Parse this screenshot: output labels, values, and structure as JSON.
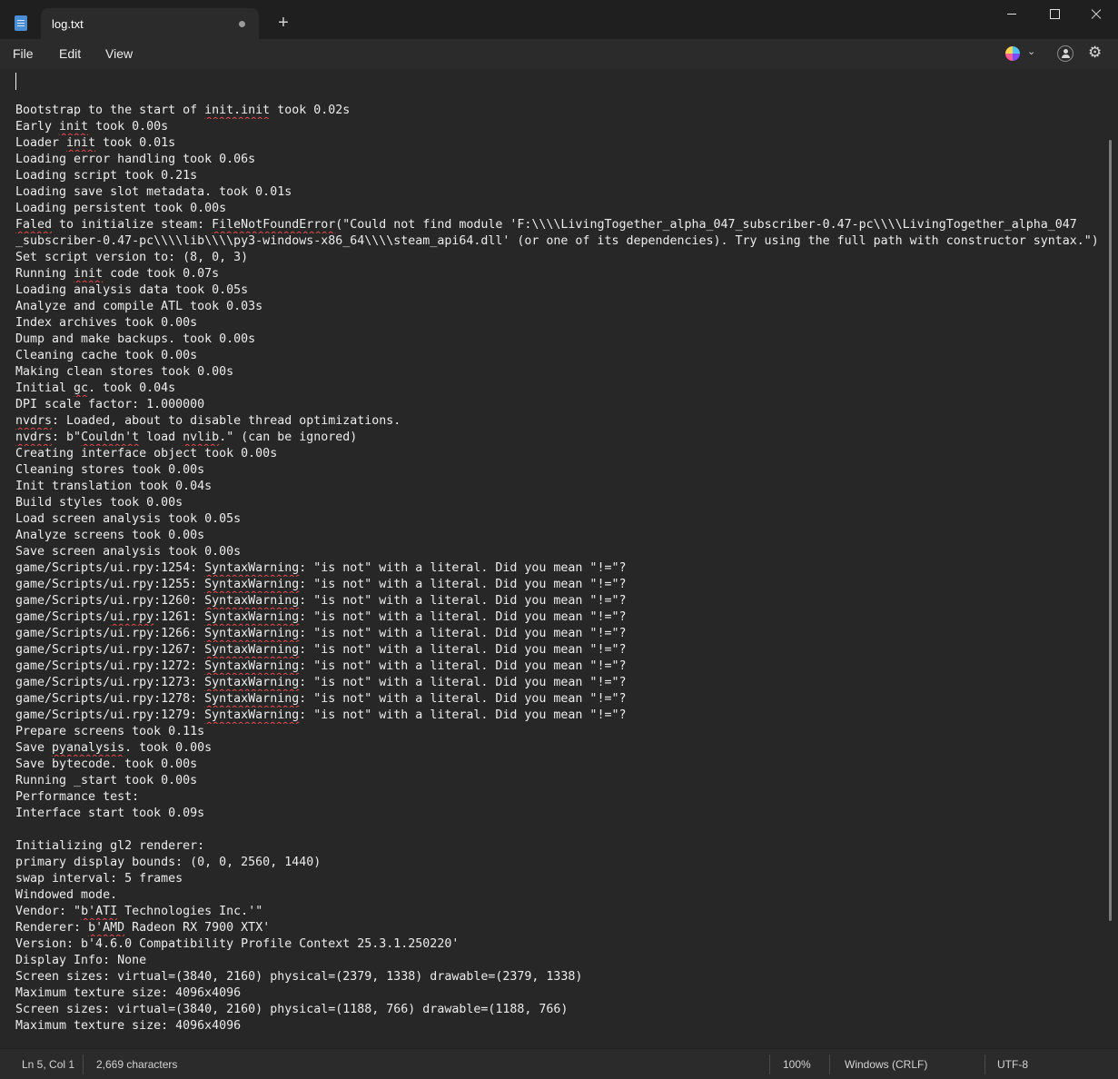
{
  "tab": {
    "title": "log.txt"
  },
  "menu": {
    "file": "File",
    "edit": "Edit",
    "view": "View"
  },
  "icons": {
    "app": "notepad-icon",
    "new_tab": "plus-icon",
    "new_tab_glyph": "+",
    "unsaved": "unsaved-dot-icon",
    "minimize": "minimize-icon",
    "maximize": "maximize-icon",
    "close": "close-icon",
    "copilot": "copilot-icon",
    "copilot_chevron": "chevron-down-icon",
    "chevron_glyph": "⌄",
    "account": "account-icon",
    "settings": "gear-icon",
    "settings_glyph": "⚙"
  },
  "colors": {
    "accent": "#4a8fd6",
    "spellcheck_underline": "#e5484d",
    "background": "#272727"
  },
  "editor": {
    "lines": [
      [
        {
          "t": ""
        }
      ],
      [
        {
          "t": "Bootstrap to the start of "
        },
        {
          "t": "init.init",
          "s": true
        },
        {
          "t": " took 0.02s"
        }
      ],
      [
        {
          "t": "Early "
        },
        {
          "t": "init",
          "s": true
        },
        {
          "t": " took 0.00s"
        }
      ],
      [
        {
          "t": "Loader "
        },
        {
          "t": "init",
          "s": true
        },
        {
          "t": " took 0.01s"
        }
      ],
      [
        {
          "t": "Loading error handling took 0.06s"
        }
      ],
      [
        {
          "t": "Loading script took 0.21s"
        }
      ],
      [
        {
          "t": "Loading save slot metadata. took 0.01s"
        }
      ],
      [
        {
          "t": "Loading persistent took 0.00s"
        }
      ],
      [
        {
          "t": "Faled",
          "s": true
        },
        {
          "t": " to initialize steam: "
        },
        {
          "t": "FileNotFoundError",
          "s": true
        },
        {
          "t": "(\"Could not find module 'F:\\\\\\\\LivingTogether_alpha_047_subscriber-0.47-pc\\\\\\\\LivingTogether_alpha_047"
        }
      ],
      [
        {
          "t": "_subscriber-0.47-pc\\\\\\\\lib\\\\\\\\py3-windows-x86_64\\\\\\\\steam_api64.dll' (or one of its dependencies). Try using the full path with constructor syntax.\")"
        }
      ],
      [
        {
          "t": "Set script version to: (8, 0, 3)"
        }
      ],
      [
        {
          "t": "Running "
        },
        {
          "t": "init",
          "s": true
        },
        {
          "t": " code took 0.07s"
        }
      ],
      [
        {
          "t": "Loading analysis data took 0.05s"
        }
      ],
      [
        {
          "t": "Analyze and compile ATL took 0.03s"
        }
      ],
      [
        {
          "t": "Index archives took 0.00s"
        }
      ],
      [
        {
          "t": "Dump and make backups. took 0.00s"
        }
      ],
      [
        {
          "t": "Cleaning cache took 0.00s"
        }
      ],
      [
        {
          "t": "Making clean stores took 0.00s"
        }
      ],
      [
        {
          "t": "Initial "
        },
        {
          "t": "gc",
          "s": true
        },
        {
          "t": ". took 0.04s"
        }
      ],
      [
        {
          "t": "DPI scale factor: 1.000000"
        }
      ],
      [
        {
          "t": "nvdrs",
          "s": true
        },
        {
          "t": ": Loaded, about to disable thread optimizations."
        }
      ],
      [
        {
          "t": "nvdrs",
          "s": true
        },
        {
          "t": ": b\""
        },
        {
          "t": "Couldn't",
          "s": true
        },
        {
          "t": " load "
        },
        {
          "t": "nvlib",
          "s": true
        },
        {
          "t": ".\" (can be ignored)"
        }
      ],
      [
        {
          "t": "Creating interface object took 0.00s"
        }
      ],
      [
        {
          "t": "Cleaning stores took 0.00s"
        }
      ],
      [
        {
          "t": "Init translation took 0.04s"
        }
      ],
      [
        {
          "t": "Build styles took 0.00s"
        }
      ],
      [
        {
          "t": "Load screen analysis took 0.05s"
        }
      ],
      [
        {
          "t": "Analyze screens took 0.00s"
        }
      ],
      [
        {
          "t": "Save screen analysis took 0.00s"
        }
      ],
      [
        {
          "t": "game/Scripts/ui.rpy:1254: "
        },
        {
          "t": "SyntaxWarning",
          "s": true
        },
        {
          "t": ": \"is not\" with a literal. Did you mean \"!=\"?"
        }
      ],
      [
        {
          "t": "game/Scripts/ui.rpy:1255: "
        },
        {
          "t": "SyntaxWarning",
          "s": true
        },
        {
          "t": ": \"is not\" with a literal. Did you mean \"!=\"?"
        }
      ],
      [
        {
          "t": "game/Scripts/ui.rpy:1260: "
        },
        {
          "t": "SyntaxWarning",
          "s": true
        },
        {
          "t": ": \"is not\" with a literal. Did you mean \"!=\"?"
        }
      ],
      [
        {
          "t": "game/Scripts/"
        },
        {
          "t": "ui.rpy",
          "s": true
        },
        {
          "t": ":1261: "
        },
        {
          "t": "SyntaxWarning",
          "s": true
        },
        {
          "t": ": \"is not\" with a literal. Did you mean \"!=\"?"
        }
      ],
      [
        {
          "t": "game/Scripts/ui.rpy:1266: "
        },
        {
          "t": "SyntaxWarning",
          "s": true
        },
        {
          "t": ": \"is not\" with a literal. Did you mean \"!=\"?"
        }
      ],
      [
        {
          "t": "game/Scripts/ui.rpy:1267: "
        },
        {
          "t": "SyntaxWarning",
          "s": true
        },
        {
          "t": ": \"is not\" with a literal. Did you mean \"!=\"?"
        }
      ],
      [
        {
          "t": "game/Scripts/ui.rpy:1272: "
        },
        {
          "t": "SyntaxWarning",
          "s": true
        },
        {
          "t": ": \"is not\" with a literal. Did you mean \"!=\"?"
        }
      ],
      [
        {
          "t": "game/Scripts/ui.rpy:1273: "
        },
        {
          "t": "SyntaxWarning",
          "s": true
        },
        {
          "t": ": \"is not\" with a literal. Did you mean \"!=\"?"
        }
      ],
      [
        {
          "t": "game/Scripts/ui.rpy:1278: "
        },
        {
          "t": "SyntaxWarning",
          "s": true
        },
        {
          "t": ": \"is not\" with a literal. Did you mean \"!=\"?"
        }
      ],
      [
        {
          "t": "game/Scripts/ui.rpy:1279: "
        },
        {
          "t": "SyntaxWarning",
          "s": true
        },
        {
          "t": ": \"is not\" with a literal. Did you mean \"!=\"?"
        }
      ],
      [
        {
          "t": "Prepare screens took 0.11s"
        }
      ],
      [
        {
          "t": "Save "
        },
        {
          "t": "pyanalysis",
          "s": true
        },
        {
          "t": ". took 0.00s"
        }
      ],
      [
        {
          "t": "Save bytecode. took 0.00s"
        }
      ],
      [
        {
          "t": "Running _start took 0.00s"
        }
      ],
      [
        {
          "t": "Performance test:"
        }
      ],
      [
        {
          "t": "Interface start took 0.09s"
        }
      ],
      [
        {
          "t": ""
        }
      ],
      [
        {
          "t": "Initializing gl2 renderer:"
        }
      ],
      [
        {
          "t": "primary display bounds: (0, 0, 2560, 1440)"
        }
      ],
      [
        {
          "t": "swap interval: 5 frames"
        }
      ],
      [
        {
          "t": "Windowed mode."
        }
      ],
      [
        {
          "t": "Vendor: \""
        },
        {
          "t": "b'ATI",
          "s": true
        },
        {
          "t": " Technologies Inc.'\""
        }
      ],
      [
        {
          "t": "Renderer: "
        },
        {
          "t": "b'AMD",
          "s": true
        },
        {
          "t": " Radeon RX 7900 XTX'"
        }
      ],
      [
        {
          "t": "Version: b'4.6.0 Compatibility Profile Context 25.3.1.250220'"
        }
      ],
      [
        {
          "t": "Display Info: None"
        }
      ],
      [
        {
          "t": "Screen sizes: virtual=(3840, 2160) physical=(2379, 1338) drawable=(2379, 1338)"
        }
      ],
      [
        {
          "t": "Maximum texture size: 4096x4096"
        }
      ],
      [
        {
          "t": "Screen sizes: virtual=(3840, 2160) physical=(1188, 766) drawable=(1188, 766)"
        }
      ],
      [
        {
          "t": "Maximum texture size: 4096x4096"
        }
      ]
    ]
  },
  "status": {
    "position": "Ln 5, Col 1",
    "characters": "2,669 characters",
    "zoom": "100%",
    "line_ending": "Windows (CRLF)",
    "encoding": "UTF-8"
  }
}
